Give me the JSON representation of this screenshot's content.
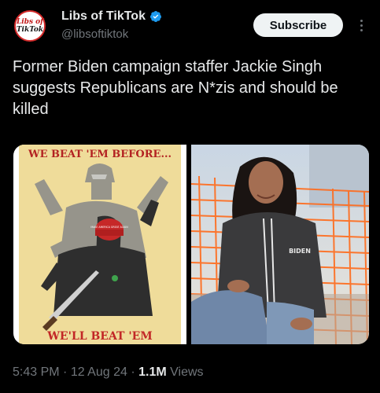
{
  "account": {
    "display_name": "Libs of TikTok",
    "handle": "@libsoftiktok",
    "avatar_line1": "Libs of",
    "avatar_line2": "TikTok",
    "verified_color": "#1d9bf0"
  },
  "subscribe_label": "Subscribe",
  "tweet": {
    "text": "Former Biden campaign staffer Jackie Singh suggests Republicans are N*zis and should be killed"
  },
  "media": {
    "poster_top_text": "WE BEAT 'EM BEFORE...",
    "poster_bottom_text": "WE'LL BEAT 'EM",
    "hat_text": "MAKE AMERICA GREAT AGAIN",
    "hoodie_text": "BIDEN"
  },
  "meta": {
    "time": "5:43 PM",
    "separator1": " · ",
    "date": "12 Aug 24",
    "separator2": " · ",
    "views_count": "1.1M",
    "views_label": " Views"
  },
  "colors": {
    "background": "#000000",
    "primary_text": "#e7e9ea",
    "secondary_text": "#71767b",
    "poster_red": "#b32222"
  }
}
